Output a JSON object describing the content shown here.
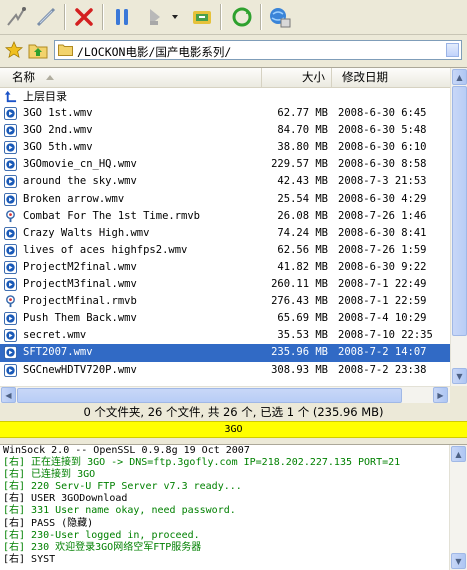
{
  "toolbar": {
    "buttons": [
      {
        "name": "connect-icon"
      },
      {
        "name": "disconnect-icon"
      },
      {
        "name": "delete-icon"
      },
      {
        "name": "pause-icon"
      },
      {
        "name": "play-icon"
      },
      {
        "name": "queue-icon"
      },
      {
        "name": "refresh-icon"
      },
      {
        "name": "site-manager-icon"
      }
    ]
  },
  "address": {
    "path": "/LOCKON电影/国产电影系列/"
  },
  "list": {
    "columns": {
      "name": "名称",
      "size": "大小",
      "date": "修改日期"
    },
    "parent_label": "上层目录",
    "rows": [
      {
        "name": "3GO 1st.wmv",
        "size": "62.77 MB",
        "date": "2008-6-30 6:45",
        "type": "wmv"
      },
      {
        "name": "3GO 2nd.wmv",
        "size": "84.70 MB",
        "date": "2008-6-30 5:48",
        "type": "wmv"
      },
      {
        "name": "3GO 5th.wmv",
        "size": "38.80 MB",
        "date": "2008-6-30 6:10",
        "type": "wmv"
      },
      {
        "name": "3GOmovie_cn_HQ.wmv",
        "size": "229.57 MB",
        "date": "2008-6-30 8:58",
        "type": "wmv"
      },
      {
        "name": "around the sky.wmv",
        "size": "42.43 MB",
        "date": "2008-7-3 21:53",
        "type": "wmv"
      },
      {
        "name": "Broken arrow.wmv",
        "size": "25.54 MB",
        "date": "2008-6-30 4:29",
        "type": "wmv"
      },
      {
        "name": "Combat For The 1st Time.rmvb",
        "size": "26.08 MB",
        "date": "2008-7-26 1:46",
        "type": "rmvb"
      },
      {
        "name": "Crazy Walts High.wmv",
        "size": "74.24 MB",
        "date": "2008-6-30 8:41",
        "type": "wmv"
      },
      {
        "name": "lives of aces highfps2.wmv",
        "size": "62.56 MB",
        "date": "2008-7-26 1:59",
        "type": "wmv"
      },
      {
        "name": "ProjectM2final.wmv",
        "size": "41.82 MB",
        "date": "2008-6-30 9:22",
        "type": "wmv"
      },
      {
        "name": "ProjectM3final.wmv",
        "size": "260.11 MB",
        "date": "2008-7-1 22:49",
        "type": "wmv"
      },
      {
        "name": "ProjectMfinal.rmvb",
        "size": "276.43 MB",
        "date": "2008-7-1 22:59",
        "type": "rmvb"
      },
      {
        "name": "Push Them Back.wmv",
        "size": "65.69 MB",
        "date": "2008-7-4 10:29",
        "type": "wmv"
      },
      {
        "name": "secret.wmv",
        "size": "35.53 MB",
        "date": "2008-7-10 22:35",
        "type": "wmv"
      },
      {
        "name": "SFT2007.wmv",
        "size": "235.96 MB",
        "date": "2008-7-2 14:07",
        "type": "wmv",
        "selected": true
      },
      {
        "name": "SGCnewHDTV720P.wmv",
        "size": "308.93 MB",
        "date": "2008-7-2 23:38",
        "type": "wmv"
      }
    ]
  },
  "status": {
    "text": "0 个文件夹, 26 个文件, 共 26 个, 已选 1 个 (235.96 MB)"
  },
  "site": {
    "name": "3GO"
  },
  "log": {
    "lines": [
      {
        "text": "WinSock 2.0 -- OpenSSL 0.9.8g 19 Oct 2007",
        "kind": "cmd"
      },
      {
        "text": "[右] 正在连接到 3GO -> DNS=ftp.3gofly.com IP=218.202.227.135 PORT=21",
        "kind": "resp"
      },
      {
        "text": "[右] 已连接到 3GO",
        "kind": "resp"
      },
      {
        "text": "[右] 220 Serv-U FTP Server v7.3 ready...",
        "kind": "resp"
      },
      {
        "text": "[右] USER 3GODownload",
        "kind": "cmd"
      },
      {
        "text": "[右] 331 User name okay, need password.",
        "kind": "resp"
      },
      {
        "text": "[右] PASS (隐藏)",
        "kind": "cmd"
      },
      {
        "text": "[右] 230-User logged in, proceed.",
        "kind": "resp"
      },
      {
        "text": "[右] 230 欢迎登录3GO网络空军FTP服务器",
        "kind": "resp"
      },
      {
        "text": "[右] SYST",
        "kind": "cmd"
      }
    ]
  }
}
